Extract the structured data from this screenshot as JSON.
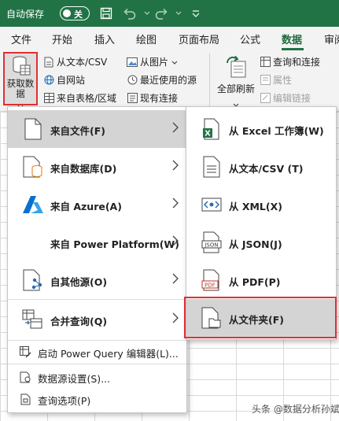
{
  "titlebar": {
    "autosave_label": "自动保存",
    "autosave_state": "关"
  },
  "tabs": [
    {
      "label": "文件"
    },
    {
      "label": "开始"
    },
    {
      "label": "插入"
    },
    {
      "label": "绘图"
    },
    {
      "label": "页面布局"
    },
    {
      "label": "公式"
    },
    {
      "label": "数据",
      "active": true
    },
    {
      "label": "审阅"
    }
  ],
  "ribbon": {
    "get_data_line1": "获取数",
    "get_data_line2": "据",
    "from_text_csv": "从文本/CSV",
    "from_web": "自网站",
    "from_table_range": "来自表格/区域",
    "from_picture": "从图片",
    "recent_sources": "最近使用的源",
    "existing_connections": "现有连接",
    "refresh_all_line1": "全部刷新",
    "queries_connections": "查询和连接",
    "properties": "属性",
    "edit_links": "编辑链接"
  },
  "menu_main": {
    "items": [
      {
        "label": "来自文件(F)",
        "has_submenu": true
      },
      {
        "label": "来自数据库(D)",
        "has_submenu": true
      },
      {
        "label": "来自 Azure(A)",
        "has_submenu": true
      },
      {
        "label": "来自 Power Platform(W)",
        "has_submenu": true
      },
      {
        "label": "自其他源(O)",
        "has_submenu": true
      },
      {
        "label": "合并查询(Q)",
        "has_submenu": true
      }
    ],
    "footer_items": [
      {
        "label": "启动 Power Query 编辑器(L)..."
      },
      {
        "label": "数据源设置(S)..."
      },
      {
        "label": "查询选项(P)"
      }
    ]
  },
  "menu_sub": {
    "items": [
      {
        "label": "从 Excel 工作簿(W)"
      },
      {
        "label": "从文本/CSV (T)"
      },
      {
        "label": "从 XML(X)"
      },
      {
        "label": "从 JSON(J)"
      },
      {
        "label": "从 PDF(P)"
      },
      {
        "label": "从文件夹(F)"
      }
    ]
  },
  "icon_text": {
    "json": "JSON",
    "pdf": "PDF",
    "excel": "X"
  },
  "watermark": "头条 @数据分析孙斌",
  "colors": {
    "title_bar": "#217346",
    "active_tab": "#1e6b3e",
    "highlight": "#d4d4d4",
    "annotation_red": "#e03030"
  }
}
